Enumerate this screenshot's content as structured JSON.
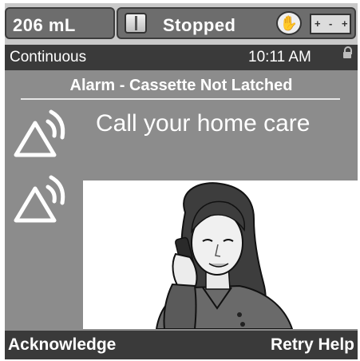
{
  "status_bar": {
    "volume": "206 mL",
    "pump_status": "Stopped",
    "cassette_icon": "cassette-icon",
    "hand_icon": "hand-stop-icon",
    "battery_icon": "battery-icon",
    "battery_symbols": [
      "+",
      "-",
      "+"
    ]
  },
  "info_bar": {
    "mode": "Continuous",
    "time": "10:11 AM",
    "lock_icon": "lock-icon"
  },
  "alarm": {
    "title": "Alarm - Cassette Not Latched",
    "message": "Call your home care",
    "icon": "alarm-triangle-icon"
  },
  "softkeys": {
    "left": "Acknowledge",
    "right": "Retry Help"
  },
  "colors": {
    "screen_background": "#8c8c8c",
    "bar_dark": "#3a3a3a",
    "status_pill": "#6d6d6d",
    "text": "#ffffff"
  }
}
